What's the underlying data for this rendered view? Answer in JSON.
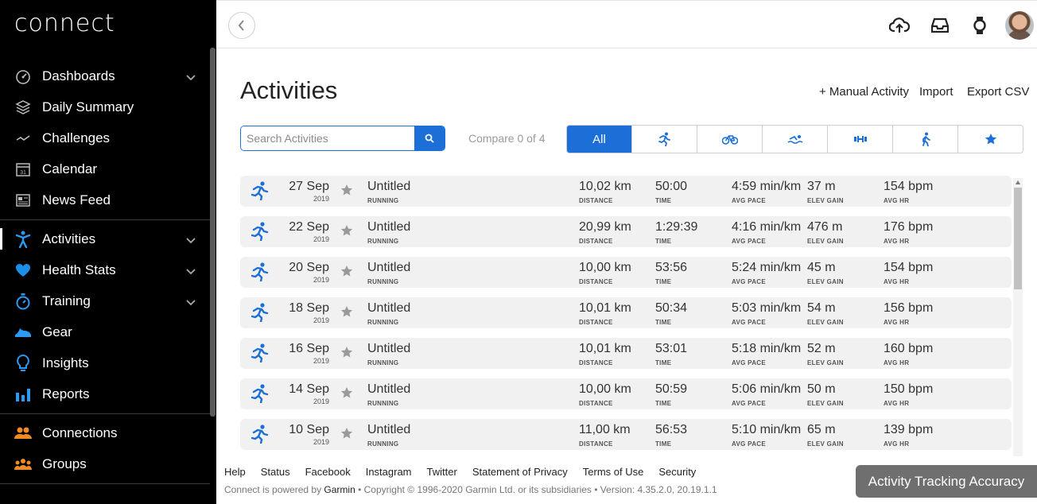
{
  "sidebar": {
    "logo": "connect",
    "items": [
      {
        "label": "Dashboards",
        "icon": "gauge-icon",
        "expandable": true
      },
      {
        "label": "Daily Summary",
        "icon": "layers-icon",
        "expandable": false
      },
      {
        "label": "Challenges",
        "icon": "trend-line-icon",
        "expandable": false
      },
      {
        "label": "Calendar",
        "icon": "calendar-icon",
        "expandable": false
      },
      {
        "label": "News Feed",
        "icon": "newspaper-icon",
        "expandable": false
      },
      {
        "label": "Activities",
        "icon": "person-activity-icon",
        "expandable": true,
        "active": true
      },
      {
        "label": "Health Stats",
        "icon": "heart-icon",
        "expandable": true
      },
      {
        "label": "Training",
        "icon": "stopwatch-icon",
        "expandable": true
      },
      {
        "label": "Gear",
        "icon": "shoe-icon",
        "expandable": false
      },
      {
        "label": "Insights",
        "icon": "lightbulb-icon",
        "expandable": false
      },
      {
        "label": "Reports",
        "icon": "bar-chart-icon",
        "expandable": false
      },
      {
        "label": "Connections",
        "icon": "people-icon",
        "expandable": false
      },
      {
        "label": "Groups",
        "icon": "group-icon",
        "expandable": false
      }
    ]
  },
  "topbar": {
    "icons": [
      "upload-cloud-icon",
      "inbox-icon",
      "watch-icon",
      "avatar"
    ]
  },
  "page": {
    "title": "Activities",
    "manual_activity": "+ Manual Activity",
    "import": "Import",
    "export_csv": "Export CSV"
  },
  "search": {
    "placeholder": "Search Activities",
    "value": ""
  },
  "compare_label": "Compare 0 of 4",
  "filters": [
    {
      "label": "All",
      "icon": "",
      "active": true
    },
    {
      "label": "",
      "icon": "running-icon"
    },
    {
      "label": "",
      "icon": "cycling-icon"
    },
    {
      "label": "",
      "icon": "swimming-icon"
    },
    {
      "label": "",
      "icon": "strength-icon"
    },
    {
      "label": "",
      "icon": "walking-icon"
    },
    {
      "label": "",
      "icon": "star-icon"
    }
  ],
  "captions": {
    "distance": "DISTANCE",
    "time": "TIME",
    "avg_pace": "AVG PACE",
    "elev_gain": "ELEV GAIN",
    "avg_hr": "AVG HR"
  },
  "activities": [
    {
      "date": "27 Sep",
      "year": "2019",
      "name": "Untitled",
      "type": "RUNNING",
      "distance": "10,02 km",
      "time": "50:00",
      "pace": "4:59 min/km",
      "elev": "37 m",
      "hr": "154 bpm"
    },
    {
      "date": "22 Sep",
      "year": "2019",
      "name": "Untitled",
      "type": "RUNNING",
      "distance": "20,99 km",
      "time": "1:29:39",
      "pace": "4:16 min/km",
      "elev": "476 m",
      "hr": "176 bpm"
    },
    {
      "date": "20 Sep",
      "year": "2019",
      "name": "Untitled",
      "type": "RUNNING",
      "distance": "10,00 km",
      "time": "53:56",
      "pace": "5:24 min/km",
      "elev": "45 m",
      "hr": "154 bpm"
    },
    {
      "date": "18 Sep",
      "year": "2019",
      "name": "Untitled",
      "type": "RUNNING",
      "distance": "10,01 km",
      "time": "50:34",
      "pace": "5:03 min/km",
      "elev": "54 m",
      "hr": "156 bpm"
    },
    {
      "date": "16 Sep",
      "year": "2019",
      "name": "Untitled",
      "type": "RUNNING",
      "distance": "10,01 km",
      "time": "53:01",
      "pace": "5:18 min/km",
      "elev": "52 m",
      "hr": "160 bpm"
    },
    {
      "date": "14 Sep",
      "year": "2019",
      "name": "Untitled",
      "type": "RUNNING",
      "distance": "10,00 km",
      "time": "50:59",
      "pace": "5:06 min/km",
      "elev": "50 m",
      "hr": "150 bpm"
    },
    {
      "date": "10 Sep",
      "year": "2019",
      "name": "Untitled",
      "type": "RUNNING",
      "distance": "11,00 km",
      "time": "56:53",
      "pace": "5:10 min/km",
      "elev": "65 m",
      "hr": "139 bpm"
    }
  ],
  "footer": {
    "links": [
      "Help",
      "Status",
      "Facebook",
      "Instagram",
      "Twitter",
      "Statement of Privacy",
      "Terms of Use",
      "Security"
    ],
    "powered_prefix": "Connect is powered by ",
    "brand": "Garmin",
    "powered_suffix": " • Copyright © 1996-2020 Garmin Ltd. or its subsidiaries • Version: 4.35.2.0, 20.19.1.1"
  },
  "accuracy_button": "Activity Tracking Accuracy",
  "colors": {
    "accent": "#1b6fd6",
    "sidebar_bg": "#000000",
    "row_bg": "#f1f1f1",
    "health_heart": "#1b8fe8",
    "social_orange": "#f08a24"
  }
}
